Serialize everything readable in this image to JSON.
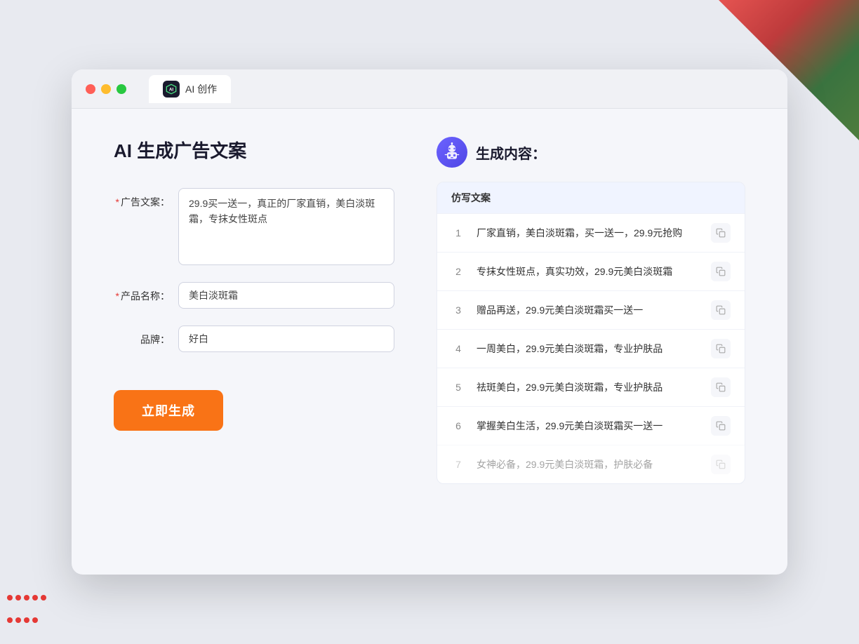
{
  "window": {
    "tab_label": "AI 创作"
  },
  "page": {
    "title": "AI 生成广告文案"
  },
  "form": {
    "ad_copy_label": "广告文案：",
    "ad_copy_required": "*",
    "ad_copy_value": "29.9买一送一，真正的厂家直销，美白淡斑霜，专抹女性斑点",
    "product_name_label": "产品名称：",
    "product_name_required": "*",
    "product_name_value": "美白淡斑霜",
    "brand_label": "品牌：",
    "brand_value": "好白",
    "generate_button": "立即生成"
  },
  "result": {
    "header_title": "生成内容：",
    "table_header": "仿写文案",
    "items": [
      {
        "id": 1,
        "text": "厂家直销，美白淡斑霜，买一送一，29.9元抢购",
        "dimmed": false
      },
      {
        "id": 2,
        "text": "专抹女性斑点，真实功效，29.9元美白淡斑霜",
        "dimmed": false
      },
      {
        "id": 3,
        "text": "赠品再送，29.9元美白淡斑霜买一送一",
        "dimmed": false
      },
      {
        "id": 4,
        "text": "一周美白，29.9元美白淡斑霜，专业护肤品",
        "dimmed": false
      },
      {
        "id": 5,
        "text": "祛斑美白，29.9元美白淡斑霜，专业护肤品",
        "dimmed": false
      },
      {
        "id": 6,
        "text": "掌握美白生活，29.9元美白淡斑霜买一送一",
        "dimmed": false
      },
      {
        "id": 7,
        "text": "女神必备，29.9元美白淡斑霜，护肤必备",
        "dimmed": true
      }
    ]
  },
  "icons": {
    "copy": "⧉",
    "robot_emoji": "🤖"
  }
}
